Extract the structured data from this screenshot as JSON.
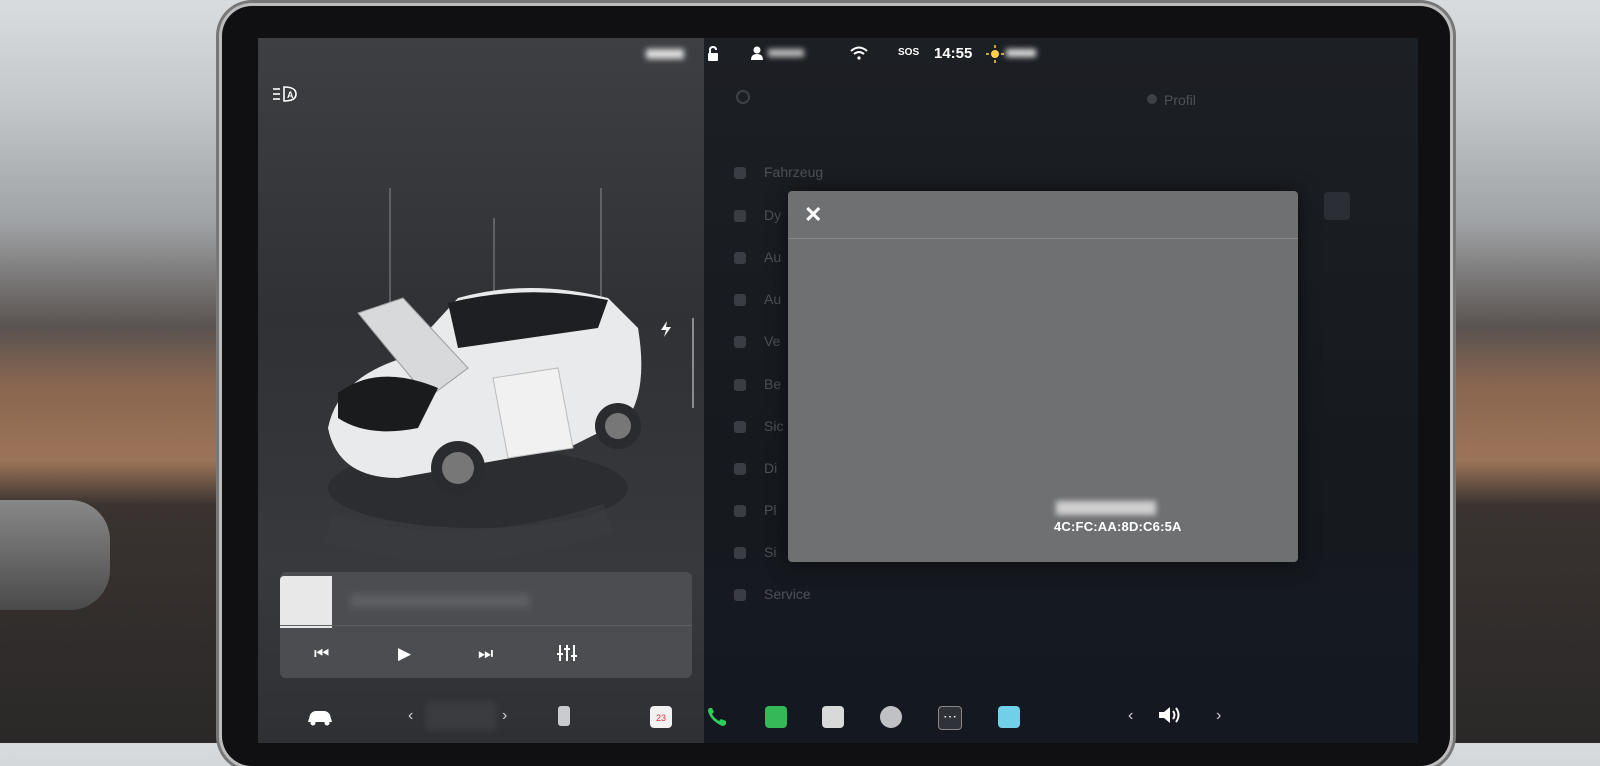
{
  "status_bar": {
    "time": "14:55",
    "sos": "SOS"
  },
  "settings_menu": {
    "profile_label": "Profil",
    "items": [
      "Fahrzeug",
      "Dy",
      "Au",
      "Au",
      "Ve",
      "Be",
      "Sic",
      "Di",
      "Pl",
      "Si",
      "Service"
    ]
  },
  "dialog": {
    "close_symbol": "✕",
    "mac_address": "4C:FC:AA:8D:C6:5A"
  },
  "media": {
    "prev_symbol": "⏮",
    "play_symbol": "▶",
    "next_symbol": "⏭"
  },
  "dock": {
    "calendar_day": "23"
  },
  "icons": {
    "headlight": "auto-headlight-icon",
    "lock": "lock-icon",
    "user": "user-icon",
    "wifi": "wifi-icon",
    "charge": "lightning-icon",
    "volume": "volume-icon"
  },
  "colors": {
    "phone": "#2fcc5a",
    "stocks": "#35b858",
    "bluetooth": "#6fd0e8"
  }
}
